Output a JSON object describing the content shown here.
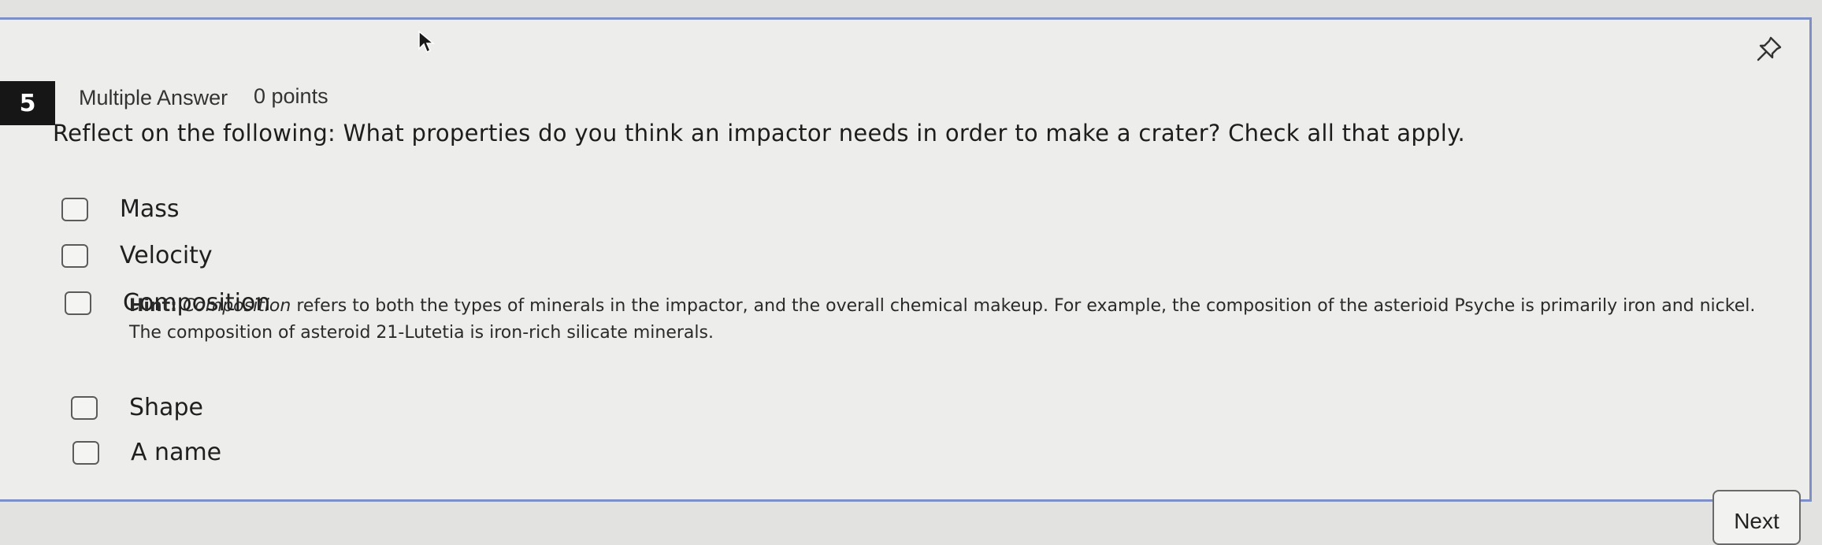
{
  "question": {
    "number": "5",
    "type": "Multiple Answer",
    "points": "0 points",
    "text": "Reflect on the following: What properties do you think an impactor needs in order to make a crater? Check all that apply."
  },
  "options": [
    {
      "label": "Mass",
      "checked": false
    },
    {
      "label": "Velocity",
      "checked": false
    },
    {
      "label": "Composition",
      "checked": false
    },
    {
      "label": "Shape",
      "checked": false
    },
    {
      "label": "A name",
      "checked": false
    }
  ],
  "hint": {
    "prefix": "Hint:",
    "term": "Composition",
    "body": " refers to both the types of minerals in the impactor, and the overall chemical makeup. For example, the composition of the asterioid Psyche is primarily iron and nickel. The composition of asteroid 21-Lutetia is iron-rich silicate minerals."
  },
  "footer": {
    "next_label": "Next"
  },
  "icons": {
    "pin": "pushpin-icon",
    "cursor": "mouse-pointer-icon"
  },
  "colors": {
    "panel_border": "#7d8fc6",
    "number_badge": "#161616"
  }
}
